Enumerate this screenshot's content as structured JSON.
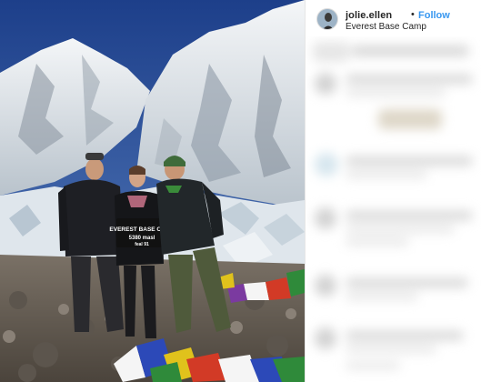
{
  "post": {
    "username": "jolie.ellen",
    "separator": "•",
    "follow_label": "Follow",
    "location": "Everest Base Camp"
  },
  "photo": {
    "sign_line1": "EVEREST BASE CAMP",
    "sign_line2": "5380 masl",
    "sign_line3": "feal 91"
  },
  "colors": {
    "follow": "#3897f0",
    "username": "#262626",
    "sky": "#3a5f98"
  },
  "icons": {
    "avatar": "avatar-image"
  }
}
